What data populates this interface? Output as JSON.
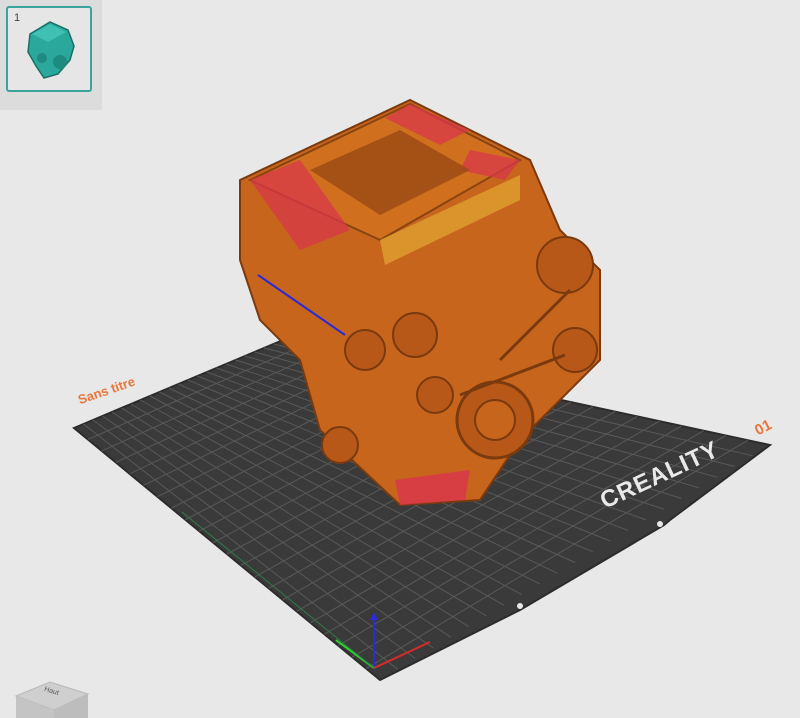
{
  "thumbnails": {
    "items": [
      {
        "index": "1",
        "icon": "engine-model-thumbnail-icon"
      }
    ]
  },
  "plate": {
    "name_label": "Sans titre",
    "number_label": "01",
    "brand_label": "CREALITY"
  },
  "viewcube": {
    "face_label": "Haut"
  },
  "colors": {
    "model_primary": "#c8651c",
    "model_accent": "#d8374a",
    "plate": "#3a3a3a",
    "grid": "#5c5c5c",
    "thumb_border": "#3aa39a",
    "label_accent": "#e8763a"
  }
}
